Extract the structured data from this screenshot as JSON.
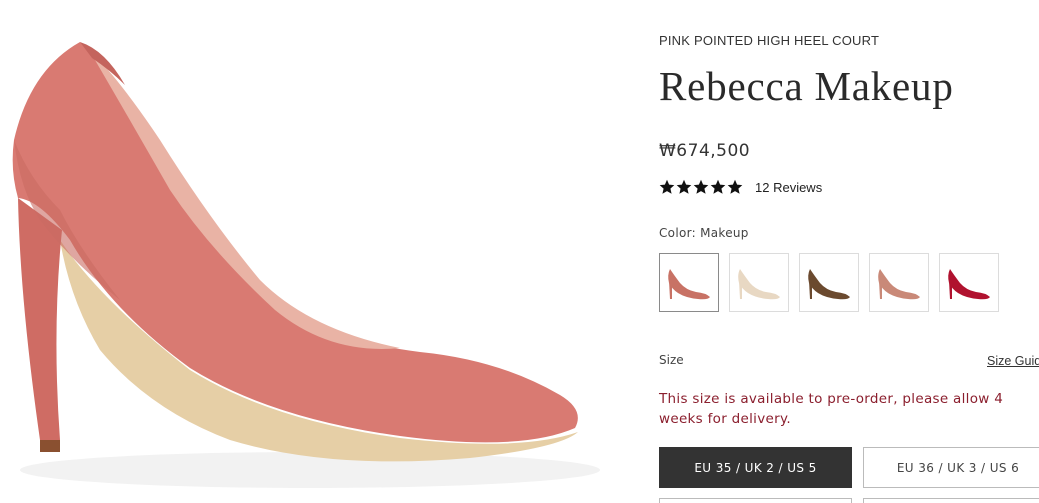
{
  "product": {
    "category": "PINK POINTED HIGH HEEL COURT",
    "name": "Rebecca Makeup",
    "price": "₩674,500",
    "rating": 5,
    "reviews_label": "12 Reviews"
  },
  "color": {
    "label": "Color: Makeup",
    "swatches": [
      {
        "color": "#c87265",
        "selected": true
      },
      {
        "color": "#e8d8c3",
        "selected": false
      },
      {
        "color": "#6b4a2f",
        "selected": false
      },
      {
        "color": "#c98978",
        "selected": false
      },
      {
        "color": "#b0122f",
        "selected": false
      }
    ]
  },
  "size": {
    "label": "Size",
    "guide_label": "Size Guide",
    "preorder_notice": "This size is available to pre-order, please allow 4 weeks for delivery.",
    "options": [
      {
        "label": "EU 35 / UK 2 / US 5",
        "selected": true
      },
      {
        "label": "EU 36 / UK 3 / US 6",
        "selected": false
      }
    ]
  },
  "colors": {
    "shoe_main": "#d97a72",
    "shoe_shadow": "#c4645d",
    "lining": "#e9b6a8",
    "sole": "#e9d1a8",
    "notice": "#8b1f2e",
    "active_button": "#333333"
  }
}
